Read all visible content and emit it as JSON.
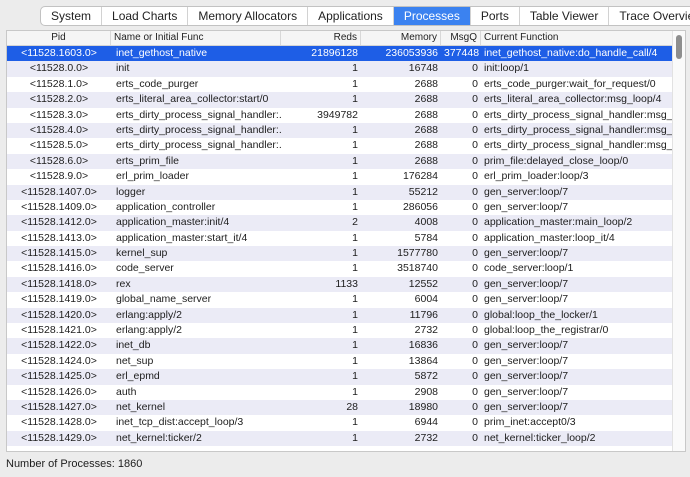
{
  "tabs": [
    {
      "label": "System",
      "active": false
    },
    {
      "label": "Load Charts",
      "active": false
    },
    {
      "label": "Memory Allocators",
      "active": false
    },
    {
      "label": "Applications",
      "active": false
    },
    {
      "label": "Processes",
      "active": true
    },
    {
      "label": "Ports",
      "active": false
    },
    {
      "label": "Table Viewer",
      "active": false
    },
    {
      "label": "Trace Overview",
      "active": false
    }
  ],
  "table": {
    "headers": {
      "pid": "Pid",
      "name": "Name or Initial Func",
      "reds": "Reds",
      "memory": "Memory",
      "msgq": "MsgQ",
      "func": "Current Function"
    },
    "rows": [
      {
        "pid": "<11528.1603.0>",
        "name": "inet_gethost_native",
        "reds": "21896128",
        "memory": "236053936",
        "msgq": "377448",
        "func": "inet_gethost_native:do_handle_call/4"
      },
      {
        "pid": "<11528.0.0>",
        "name": "init",
        "reds": "1",
        "memory": "16748",
        "msgq": "0",
        "func": "init:loop/1"
      },
      {
        "pid": "<11528.1.0>",
        "name": "erts_code_purger",
        "reds": "1",
        "memory": "2688",
        "msgq": "0",
        "func": "erts_code_purger:wait_for_request/0"
      },
      {
        "pid": "<11528.2.0>",
        "name": "erts_literal_area_collector:start/0",
        "reds": "1",
        "memory": "2688",
        "msgq": "0",
        "func": "erts_literal_area_collector:msg_loop/4"
      },
      {
        "pid": "<11528.3.0>",
        "name": "erts_dirty_process_signal_handler:...",
        "reds": "3949782",
        "memory": "2688",
        "msgq": "0",
        "func": "erts_dirty_process_signal_handler:msg_lo..."
      },
      {
        "pid": "<11528.4.0>",
        "name": "erts_dirty_process_signal_handler:...",
        "reds": "1",
        "memory": "2688",
        "msgq": "0",
        "func": "erts_dirty_process_signal_handler:msg_lo..."
      },
      {
        "pid": "<11528.5.0>",
        "name": "erts_dirty_process_signal_handler:...",
        "reds": "1",
        "memory": "2688",
        "msgq": "0",
        "func": "erts_dirty_process_signal_handler:msg_lo..."
      },
      {
        "pid": "<11528.6.0>",
        "name": "erts_prim_file",
        "reds": "1",
        "memory": "2688",
        "msgq": "0",
        "func": "prim_file:delayed_close_loop/0"
      },
      {
        "pid": "<11528.9.0>",
        "name": "erl_prim_loader",
        "reds": "1",
        "memory": "176284",
        "msgq": "0",
        "func": "erl_prim_loader:loop/3"
      },
      {
        "pid": "<11528.1407.0>",
        "name": "logger",
        "reds": "1",
        "memory": "55212",
        "msgq": "0",
        "func": "gen_server:loop/7"
      },
      {
        "pid": "<11528.1409.0>",
        "name": "application_controller",
        "reds": "1",
        "memory": "286056",
        "msgq": "0",
        "func": "gen_server:loop/7"
      },
      {
        "pid": "<11528.1412.0>",
        "name": "application_master:init/4",
        "reds": "2",
        "memory": "4008",
        "msgq": "0",
        "func": "application_master:main_loop/2"
      },
      {
        "pid": "<11528.1413.0>",
        "name": "application_master:start_it/4",
        "reds": "1",
        "memory": "5784",
        "msgq": "0",
        "func": "application_master:loop_it/4"
      },
      {
        "pid": "<11528.1415.0>",
        "name": "kernel_sup",
        "reds": "1",
        "memory": "1577780",
        "msgq": "0",
        "func": "gen_server:loop/7"
      },
      {
        "pid": "<11528.1416.0>",
        "name": "code_server",
        "reds": "1",
        "memory": "3518740",
        "msgq": "0",
        "func": "code_server:loop/1"
      },
      {
        "pid": "<11528.1418.0>",
        "name": "rex",
        "reds": "1133",
        "memory": "12552",
        "msgq": "0",
        "func": "gen_server:loop/7"
      },
      {
        "pid": "<11528.1419.0>",
        "name": "global_name_server",
        "reds": "1",
        "memory": "6004",
        "msgq": "0",
        "func": "gen_server:loop/7"
      },
      {
        "pid": "<11528.1420.0>",
        "name": "erlang:apply/2",
        "reds": "1",
        "memory": "11796",
        "msgq": "0",
        "func": "global:loop_the_locker/1"
      },
      {
        "pid": "<11528.1421.0>",
        "name": "erlang:apply/2",
        "reds": "1",
        "memory": "2732",
        "msgq": "0",
        "func": "global:loop_the_registrar/0"
      },
      {
        "pid": "<11528.1422.0>",
        "name": "inet_db",
        "reds": "1",
        "memory": "16836",
        "msgq": "0",
        "func": "gen_server:loop/7"
      },
      {
        "pid": "<11528.1424.0>",
        "name": "net_sup",
        "reds": "1",
        "memory": "13864",
        "msgq": "0",
        "func": "gen_server:loop/7"
      },
      {
        "pid": "<11528.1425.0>",
        "name": "erl_epmd",
        "reds": "1",
        "memory": "5872",
        "msgq": "0",
        "func": "gen_server:loop/7"
      },
      {
        "pid": "<11528.1426.0>",
        "name": "auth",
        "reds": "1",
        "memory": "2908",
        "msgq": "0",
        "func": "gen_server:loop/7"
      },
      {
        "pid": "<11528.1427.0>",
        "name": "net_kernel",
        "reds": "28",
        "memory": "18980",
        "msgq": "0",
        "func": "gen_server:loop/7"
      },
      {
        "pid": "<11528.1428.0>",
        "name": "inet_tcp_dist:accept_loop/3",
        "reds": "1",
        "memory": "6944",
        "msgq": "0",
        "func": "prim_inet:accept0/3"
      },
      {
        "pid": "<11528.1429.0>",
        "name": "net_kernel:ticker/2",
        "reds": "1",
        "memory": "2732",
        "msgq": "0",
        "func": "net_kernel:ticker_loop/2"
      }
    ],
    "selected_index": 0
  },
  "status": {
    "text": "Number of Processes: 1860"
  }
}
